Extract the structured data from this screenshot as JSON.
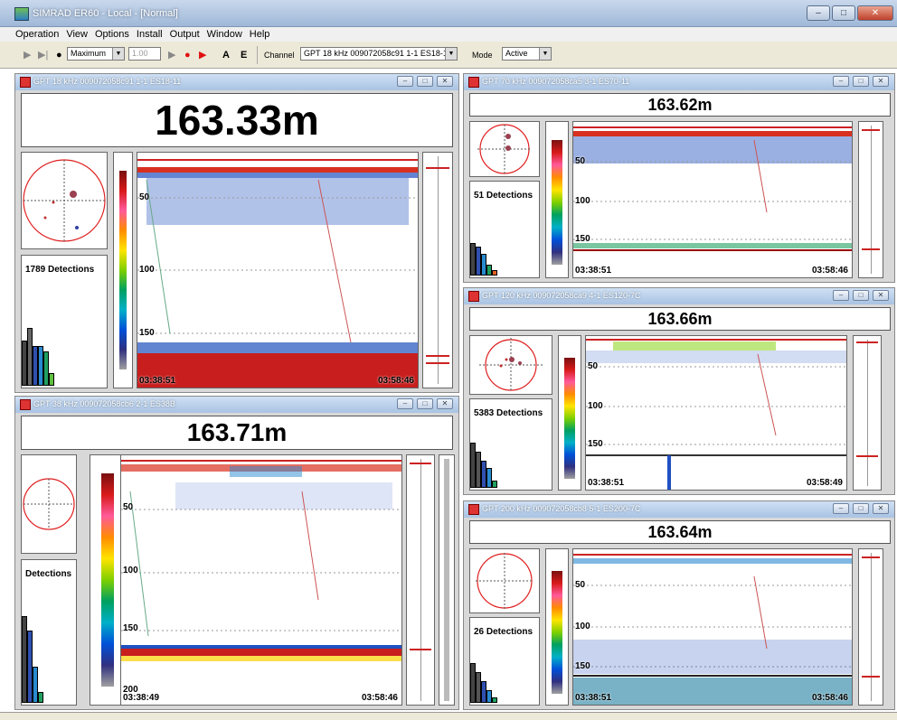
{
  "window": {
    "title": "SIMRAD ER60 - Local - [Normal]"
  },
  "menu": [
    "Operation",
    "View",
    "Options",
    "Install",
    "Output",
    "Window",
    "Help"
  ],
  "toolbar": {
    "ping_mode": "Maximum",
    "interval": "1.00",
    "btn_a": "A",
    "btn_e": "E",
    "channel_label": "Channel",
    "channel_value": "GPT 18 kHz 009072058c91 1-1 ES18-11",
    "mode_label": "Mode",
    "mode_value": "Active"
  },
  "panels": [
    {
      "title": "GPT 18 kHz 009072058c91 1-1 ES18-11",
      "depth": "163.33m",
      "detections": "1789 Detections",
      "depth_labels": [
        "50",
        "100",
        "150"
      ],
      "time_start": "03:38:51",
      "time_end": "03:58:46"
    },
    {
      "title": "GPT 38 kHz 009072058cb6 2-1 ES38B",
      "depth": "163.71m",
      "detections": "Detections",
      "depth_labels": [
        "50",
        "100",
        "150",
        "200"
      ],
      "time_start": "03:38:49",
      "time_end": "03:58:46"
    },
    {
      "title": "GPT 70 kHz 009072058ca5 3-1 ES70-11",
      "depth": "163.62m",
      "detections": "51 Detections",
      "depth_labels": [
        "50",
        "100",
        "150"
      ],
      "time_start": "03:38:51",
      "time_end": "03:58:46"
    },
    {
      "title": "GPT 120 kHz 009072058ca9 4-1 ES120-7C",
      "depth": "163.66m",
      "detections": "5383 Detections",
      "depth_labels": [
        "50",
        "100",
        "150"
      ],
      "time_start": "03:38:51",
      "time_end": "03:58:49"
    },
    {
      "title": "GPT 200 kHz 009072058cb8 5-1 ES200-7C",
      "depth": "163.64m",
      "detections": "26 Detections",
      "depth_labels": [
        "50",
        "100",
        "150"
      ],
      "time_start": "03:38:51",
      "time_end": "03:58:46"
    }
  ],
  "colors": {
    "bottom_echo": "#c81e1e",
    "surface_band": "#d83020",
    "fish_blue": "#1f4fbf"
  }
}
